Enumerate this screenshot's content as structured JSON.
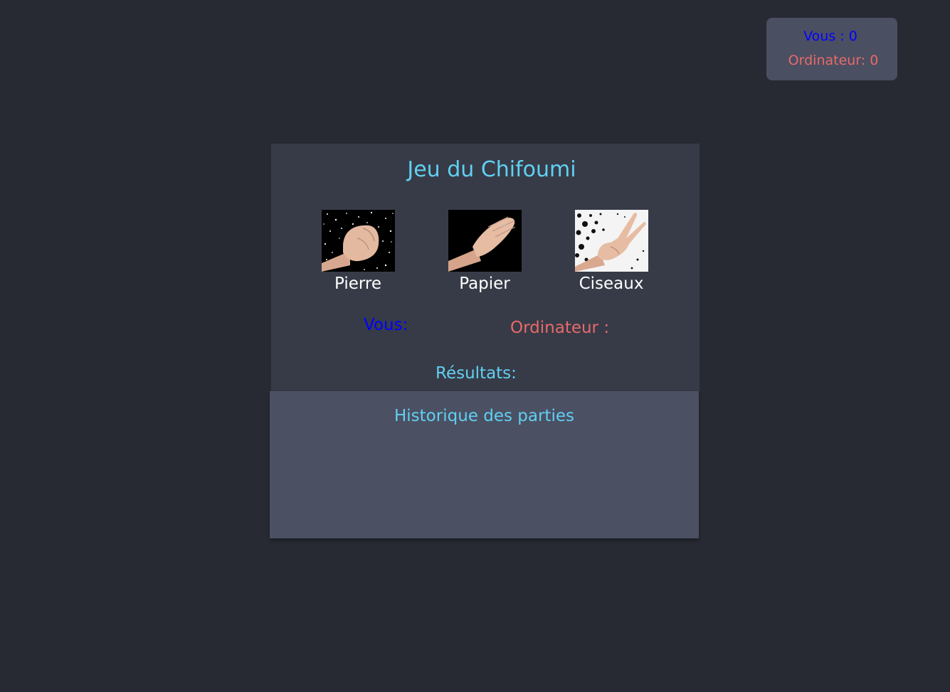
{
  "scoreboard": {
    "you": "Vous : 0",
    "computer": "Ordinateur: 0"
  },
  "game": {
    "title": "Jeu du Chifoumi",
    "choices": [
      {
        "label": "Pierre",
        "icon": "fist-rock-hand-icon"
      },
      {
        "label": "Papier",
        "icon": "flat-paper-hand-icon"
      },
      {
        "label": "Ciseaux",
        "icon": "v-scissors-hand-icon"
      }
    ],
    "you_label": "Vous:",
    "computer_label": "Ordinateur :",
    "results_label": "Résultats:"
  },
  "history": {
    "title": "Historique des parties"
  },
  "colors": {
    "background": "#272a33",
    "card": "#373b47",
    "panel": "#4b5063",
    "accent": "#61d0f2",
    "player": "#0000ff",
    "computer": "#e86a6a"
  }
}
